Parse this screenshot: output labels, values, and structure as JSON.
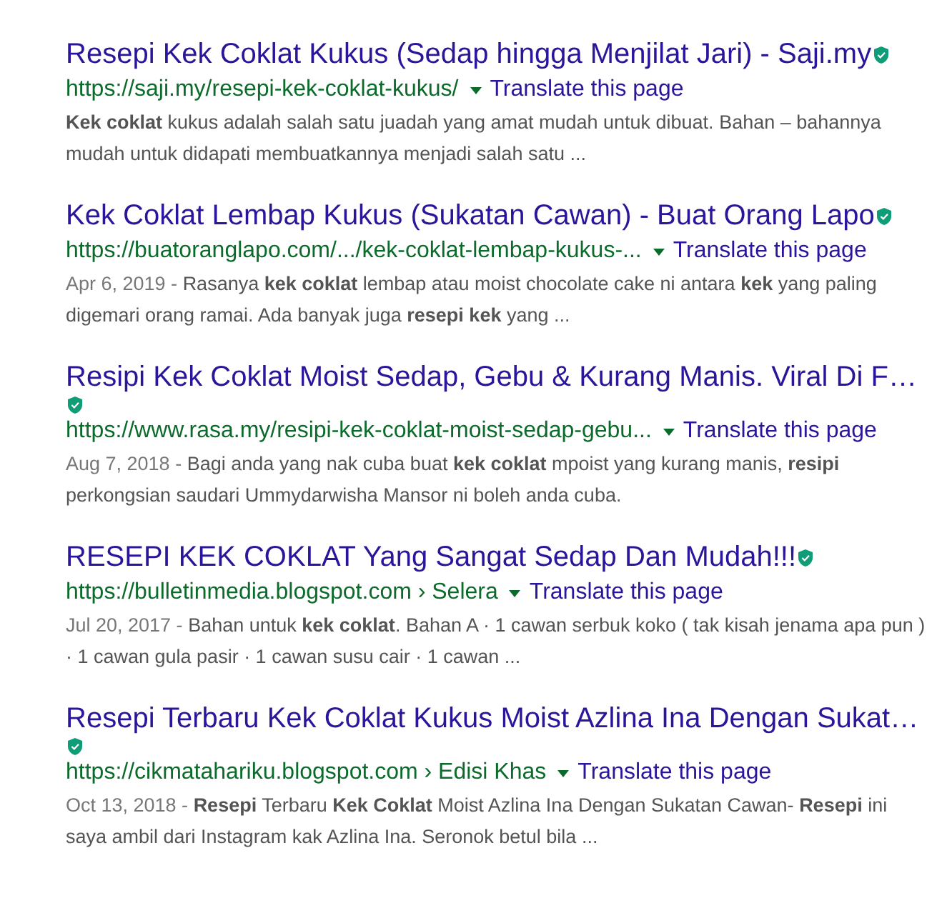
{
  "results": [
    {
      "title": "Resepi Kek Coklat Kukus (Sedap hingga Menjilat Jari) - Saji.my",
      "url": "https://saji.my/resepi-kek-coklat-kukus/",
      "translate": "Translate this page",
      "snippet": "**Kek coklat** kukus adalah salah satu juadah yang amat mudah untuk dibuat. Bahan – bahannya mudah untuk didapati membuatkannya menjadi salah satu ..."
    },
    {
      "title": "Kek Coklat Lembap Kukus (Sukatan Cawan) - Buat Orang Lapo",
      "url": "https://buatoranglapo.com/.../kek-coklat-lembap-kukus-...",
      "translate": "Translate this page",
      "date": "Apr 6, 2019 - ",
      "snippet": "Rasanya **kek coklat** lembap atau moist chocolate cake ni antara **kek** yang paling digemari orang ramai. Ada banyak juga **resepi kek** yang ..."
    },
    {
      "title": "Resipi Kek Coklat Moist Sedap, Gebu & Kurang Manis. Viral Di F…",
      "url": "https://www.rasa.my/resipi-kek-coklat-moist-sedap-gebu...",
      "translate": "Translate this page",
      "date": "Aug 7, 2018 - ",
      "snippet": "Bagi anda yang nak cuba buat **kek coklat** mpoist yang kurang manis, **resipi** perkongsian saudari Ummydarwisha Mansor ni boleh anda cuba."
    },
    {
      "title": "RESEPI KEK COKLAT Yang Sangat Sedap Dan Mudah!!!",
      "url": "https://bulletinmedia.blogspot.com › Selera",
      "translate": "Translate this page",
      "date": "Jul 20, 2017 - ",
      "snippet": "Bahan untuk **kek coklat**. Bahan A · 1 cawan serbuk koko ( tak kisah jenama apa pun ) · 1 cawan gula pasir · 1 cawan susu cair · 1 cawan ..."
    },
    {
      "title": "Resepi Terbaru Kek Coklat Kukus Moist Azlina Ina Dengan Sukat…",
      "url": "https://cikmatahariku.blogspot.com › Edisi Khas",
      "translate": "Translate this page",
      "date": "Oct 13, 2018 - ",
      "snippet": "**Resepi** Terbaru **Kek Coklat** Moist Azlina Ina Dengan Sukatan Cawan- **Resepi** ini saya ambil dari Instagram kak Azlina Ina. Seronok betul bila ..."
    }
  ]
}
